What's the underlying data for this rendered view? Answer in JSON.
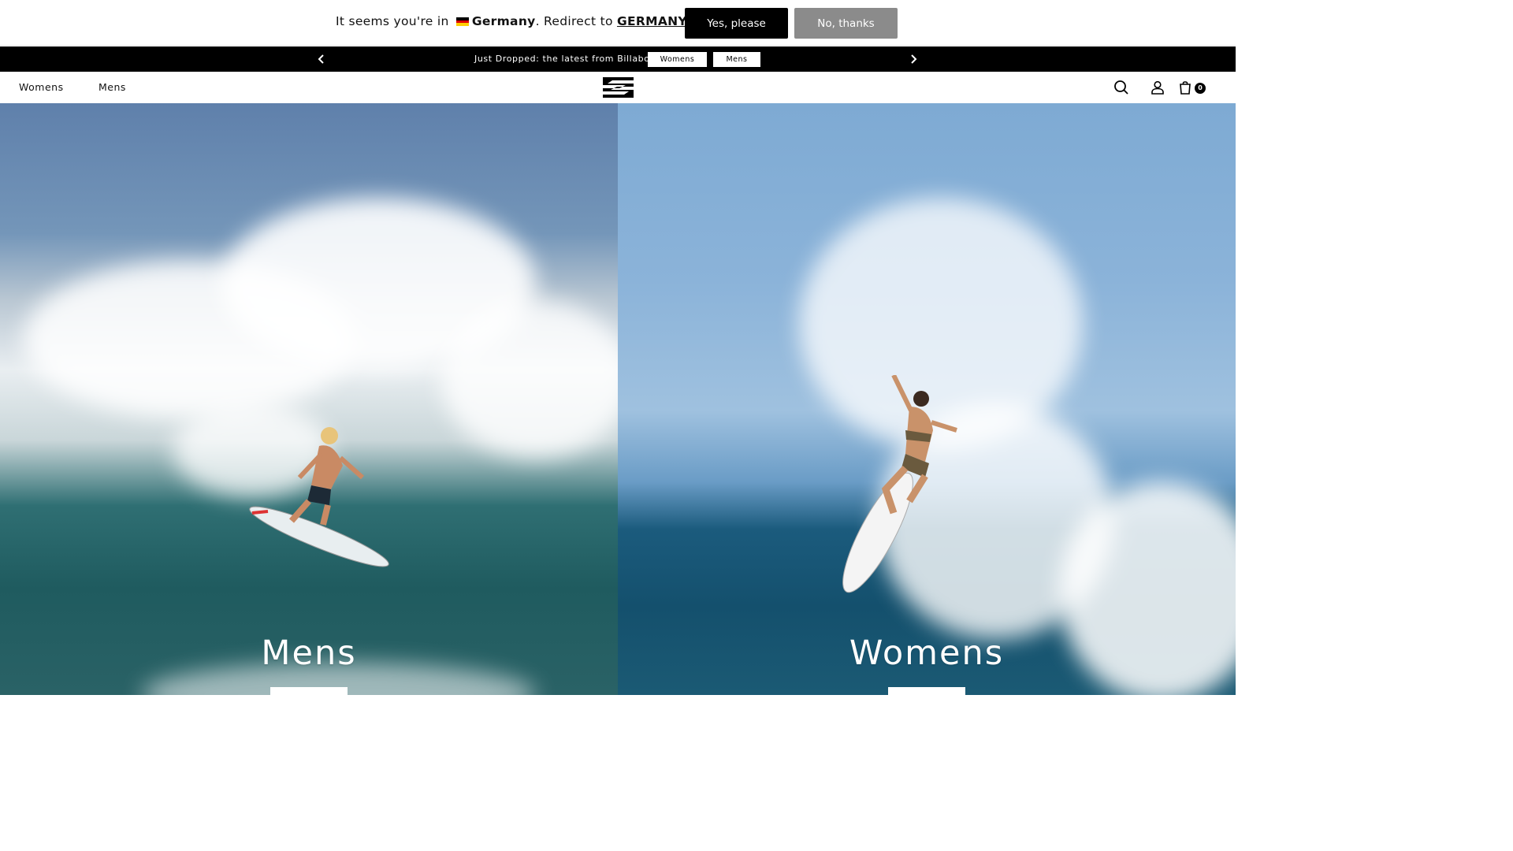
{
  "geo_banner": {
    "prefix": "It seems you're in",
    "country": "Germany",
    "middle": ". Redirect to",
    "redirect_target": "GERMANY",
    "suffix": "?",
    "yes_label": "Yes, please",
    "no_label": "No, thanks",
    "flag_icon": "germany-flag-icon"
  },
  "announcement": {
    "text": "Just Dropped: the latest from Billabong",
    "womens_label": "Womens",
    "mens_label": "Mens",
    "prev_icon": "chevron-left-icon",
    "next_icon": "chevron-right-icon"
  },
  "header": {
    "nav": [
      "Womens",
      "Mens"
    ],
    "logo_icon": "billabong-logo-icon",
    "search_icon": "search-icon",
    "account_icon": "user-icon",
    "cart_icon": "shopping-bag-icon",
    "cart_count": "0"
  },
  "hero": {
    "left_title": "Mens",
    "right_title": "Womens"
  },
  "colors": {
    "accent": "#000000",
    "secondary_button": "#8b8b8b",
    "announcement_bg": "#000000"
  }
}
